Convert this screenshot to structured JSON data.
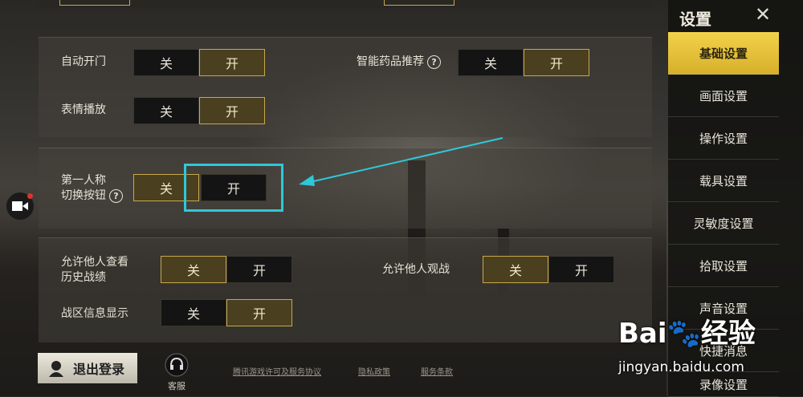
{
  "sidebar": {
    "title": "设置",
    "items": [
      {
        "label": "基础设置",
        "active": true
      },
      {
        "label": "画面设置"
      },
      {
        "label": "操作设置"
      },
      {
        "label": "载具设置"
      },
      {
        "label": "灵敏度设置"
      },
      {
        "label": "拾取设置"
      },
      {
        "label": "声音设置"
      },
      {
        "label": "快捷消息"
      },
      {
        "label": "录像设置"
      }
    ]
  },
  "settings": {
    "auto_door": {
      "label": "自动开门",
      "off": "关",
      "on": "开",
      "selected": "on"
    },
    "emote": {
      "label": "表情播放",
      "off": "关",
      "on": "开",
      "selected": "on"
    },
    "smart_medicine": {
      "label": "智能药品推荐",
      "off": "关",
      "on": "开",
      "selected": "on"
    },
    "fpp_switch": {
      "label_line1": "第一人称",
      "label_line2": "切换按钮",
      "off": "关",
      "on": "开",
      "selected": "off"
    },
    "allow_history": {
      "label_line1": "允许他人查看",
      "label_line2": "历史战绩",
      "off": "关",
      "on": "开",
      "selected": "off"
    },
    "allow_spectate": {
      "label": "允许他人观战",
      "off": "关",
      "on": "开",
      "selected": "off"
    },
    "zone_info": {
      "label": "战区信息显示",
      "off": "关",
      "on": "开",
      "selected": "on"
    }
  },
  "footer": {
    "logout": "退出登录",
    "customer_service": "客服",
    "links": [
      "腾讯游戏许可及服务协议",
      "隐私政策",
      "服务条款"
    ]
  },
  "watermark": {
    "brand": "Bai",
    "brand2": "经验",
    "url": "jingyan.baidu.com"
  },
  "colors": {
    "accent": "#c8a84a",
    "active_tab": "#f2d24a",
    "highlight": "#2ec8d8"
  }
}
